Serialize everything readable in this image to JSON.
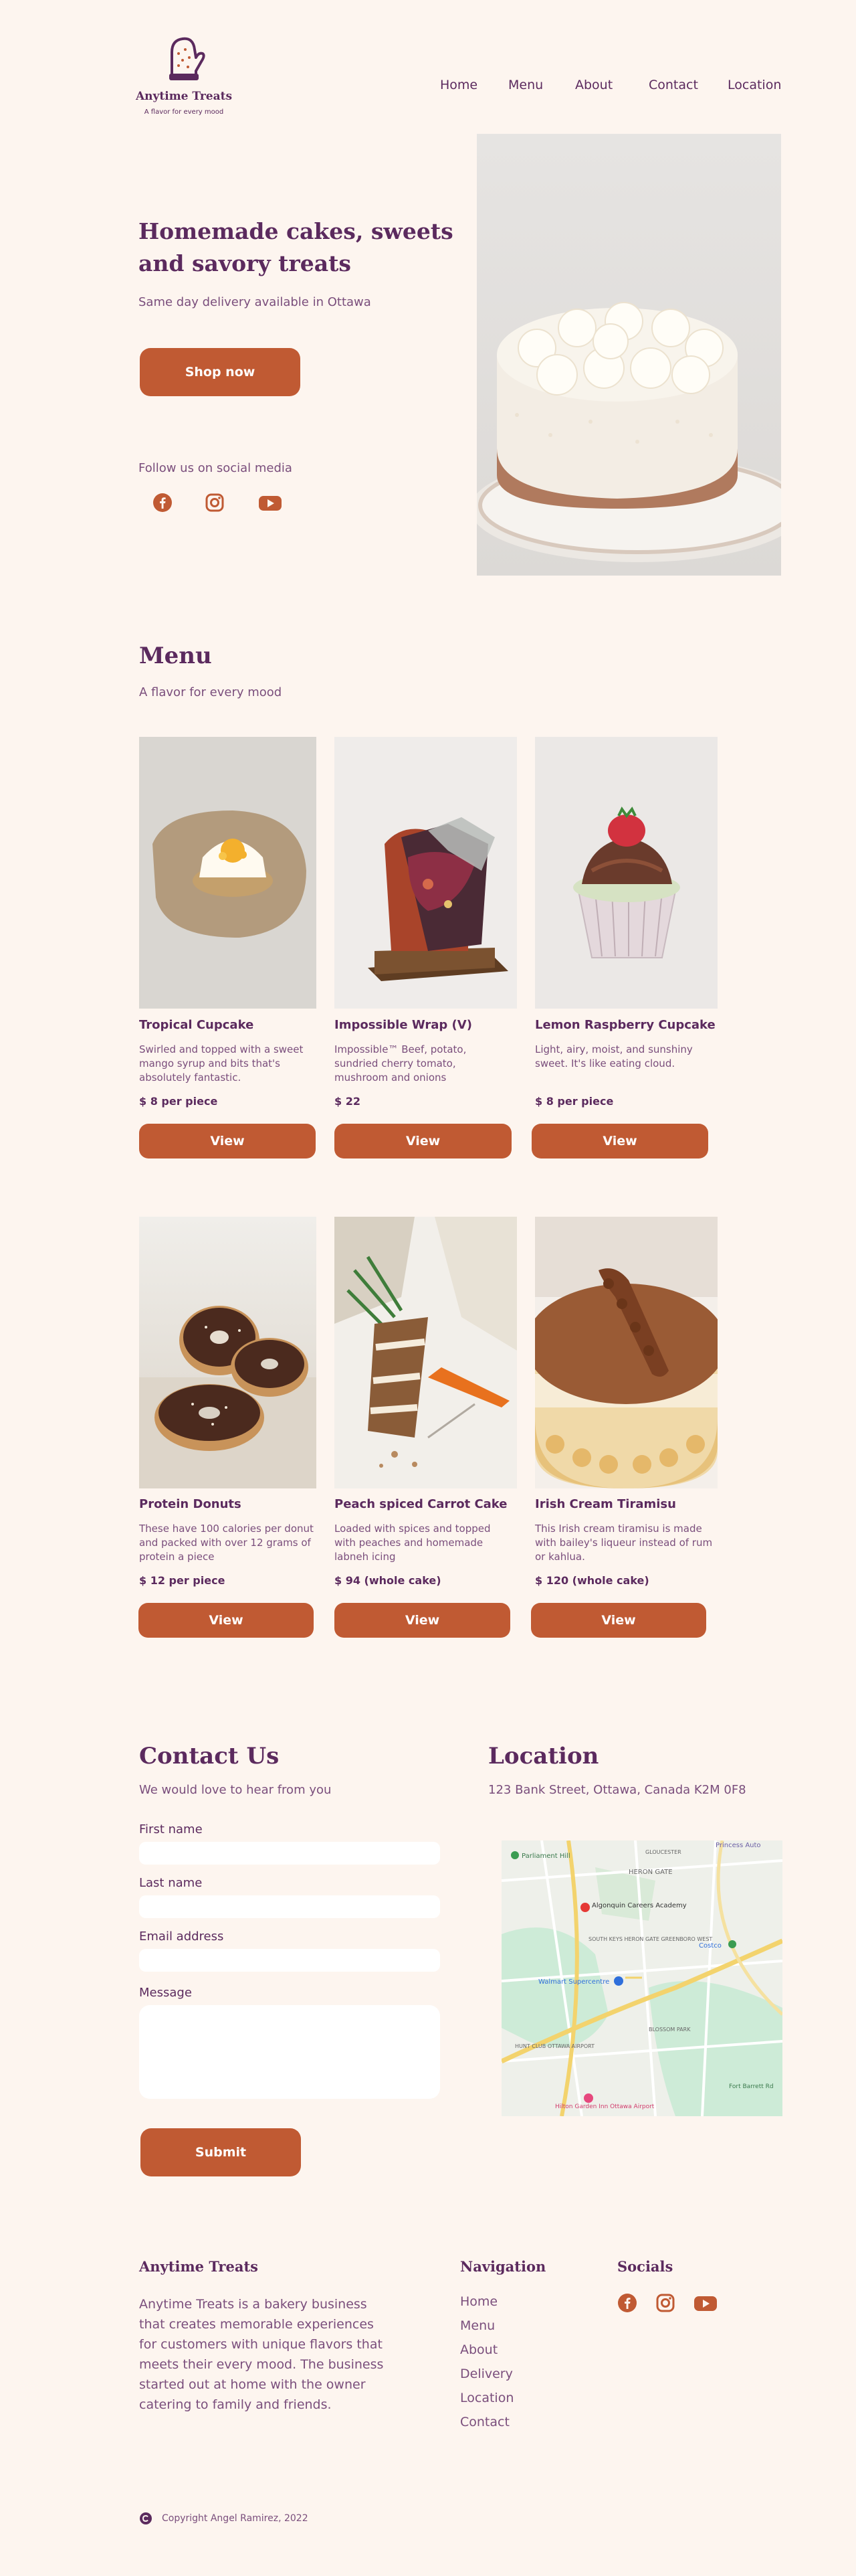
{
  "brand": {
    "name": "Anytime Treats",
    "tagline": "A flavor for every mood"
  },
  "nav": [
    "Home",
    "Menu",
    "About",
    "Contact",
    "Location"
  ],
  "hero": {
    "title_line1": "Homemade cakes, sweets",
    "title_line2": "and savory treats",
    "subtitle": "Same day delivery available in Ottawa",
    "cta": "Shop now",
    "social_label": "Follow us on social media"
  },
  "menu": {
    "title": "Menu",
    "subtitle": "A flavor for every mood",
    "view_label": "View",
    "items": [
      {
        "name": "Tropical Cupcake",
        "desc": "Swirled and topped with a sweet mango syrup and bits that's absolutely fantastic.",
        "price": "$ 8 per piece"
      },
      {
        "name": "Impossible Wrap (V)",
        "desc": "Impossible™ Beef, potato, sundried cherry tomato, mushroom and onions",
        "price": "$ 22"
      },
      {
        "name": "Lemon Raspberry Cupcake",
        "desc": "Light, airy, moist, and sunshiny sweet. It's like eating cloud.",
        "price": "$ 8 per piece"
      },
      {
        "name": "Protein Donuts",
        "desc": "These have 100 calories per donut and packed with over 12 grams of protein a piece",
        "price": "$ 12 per piece"
      },
      {
        "name": "Peach spiced Carrot Cake",
        "desc": "Loaded with spices and topped with peaches and homemade labneh icing",
        "price": "$ 94 (whole cake)"
      },
      {
        "name": "Irish Cream Tiramisu",
        "desc": "This Irish cream tiramisu is made with bailey's liqueur instead of rum or kahlua.",
        "price": "$ 120 (whole cake)"
      }
    ]
  },
  "contact": {
    "title": "Contact Us",
    "subtitle": "We would love to hear from you",
    "fields": [
      "First name",
      "Last name",
      "Email address",
      "Message"
    ],
    "submit": "Submit"
  },
  "location": {
    "title": "Location",
    "address": "123 Bank Street, Ottawa, Canada K2M 0F8",
    "map_labels": [
      "Princess Auto",
      "Parliament Hill",
      "HERON GATE",
      "Algonquin Careers Academy",
      "Costco",
      "SOUTH KEYS HERON GATE GREENBORO WEST",
      "Walmart Supercentre",
      "GLOUCESTER",
      "BLOSSOM PARK",
      "HUNT CLUB OTTAWA AIRPORT",
      "Hilton Garden Inn Ottawa Airport",
      "Fort Barrett Rd"
    ]
  },
  "footer": {
    "about_title": "Anytime Treats",
    "about_text_lines": [
      "Anytime Treats is a bakery business",
      "that creates memorable experiences",
      "for customers with unique flavors that",
      "meets their every mood. The business",
      "started out at home with the owner",
      "catering to family and friends."
    ],
    "nav_title": "Navigation",
    "nav_links": [
      "Home",
      "Menu",
      "About",
      "Delivery",
      "Location",
      "Contact"
    ],
    "socials_title": "Socials",
    "copyright": "Copyright Angel Ramirez, 2022"
  },
  "colors": {
    "background": "#fdf5ef",
    "accent": "#c05a33",
    "text": "#5b2a5e"
  }
}
